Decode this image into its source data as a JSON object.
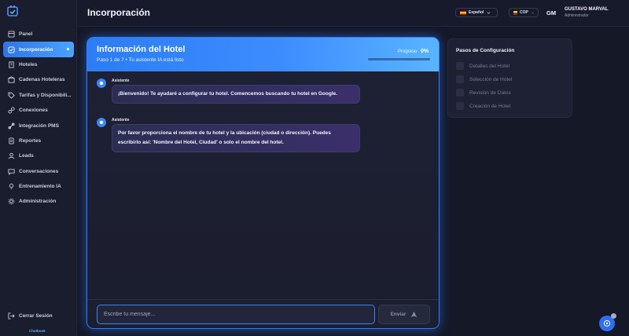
{
  "sidebar": {
    "items": [
      {
        "label": "Panel",
        "icon": "dashboard-icon",
        "active": false
      },
      {
        "label": "Incorporación",
        "icon": "onboarding-icon",
        "active": true
      },
      {
        "label": "Hoteles",
        "icon": "building-icon",
        "active": false
      },
      {
        "label": "Cadenas Hoteleras",
        "icon": "hotel-chain-icon",
        "active": false
      },
      {
        "label": "Tarifas y Disponibili...",
        "icon": "tag-icon",
        "active": false
      },
      {
        "label": "Conexiones",
        "icon": "link-icon",
        "active": false
      },
      {
        "label": "Integración PMS",
        "icon": "integration-icon",
        "active": false
      },
      {
        "label": "Reportes",
        "icon": "report-icon",
        "active": false
      },
      {
        "label": "Leads",
        "icon": "leads-icon",
        "active": false
      },
      {
        "label": "Conversaciones",
        "icon": "chat-icon",
        "active": false
      },
      {
        "label": "Entrenamiento IA",
        "icon": "bulb-icon",
        "active": false
      },
      {
        "label": "Administración",
        "icon": "gear-icon",
        "active": false
      }
    ],
    "logout_label": "Cerrar Sesión",
    "brand": "Chatbook"
  },
  "header": {
    "title": "Incorporación",
    "language": "Español",
    "currency": "COP",
    "user_initials": "GM",
    "user_name": "GUSTAVO MARVAL",
    "user_role": "Administrador"
  },
  "card": {
    "title": "Información del Hotel",
    "subtitle": "Paso 1 de 7 • Tu asistente IA está listo",
    "progress_label": "Progreso",
    "progress_text": "0%",
    "progress_fraction": 0
  },
  "messages": [
    {
      "sender": "Asistente",
      "text": "¡Bienvenido! Te ayudaré a configurar tu hotel. Comencemos buscando tu hotel en Google."
    },
    {
      "sender": "Asistente",
      "text": "Por favor proporciona el nombre de tu hotel y la ubicación (ciudad o dirección). Puedes escribirlo así: 'Nombre del Hotel, Ciudad' o solo el nombre del hotel."
    }
  ],
  "composer": {
    "placeholder": "Escribe tu mensaje...",
    "send_label": "Enviar"
  },
  "steps": {
    "title": "Pasos de Configuración",
    "items": [
      "Detalles del Hotel",
      "Selección de Hotel",
      "Revisión de Datos",
      "Creación de Hotel"
    ]
  },
  "colors": {
    "accent": "#2f7bff",
    "background": "#151827",
    "bubble_start": "#2a2e52",
    "bubble_end": "#3b2f6b"
  }
}
